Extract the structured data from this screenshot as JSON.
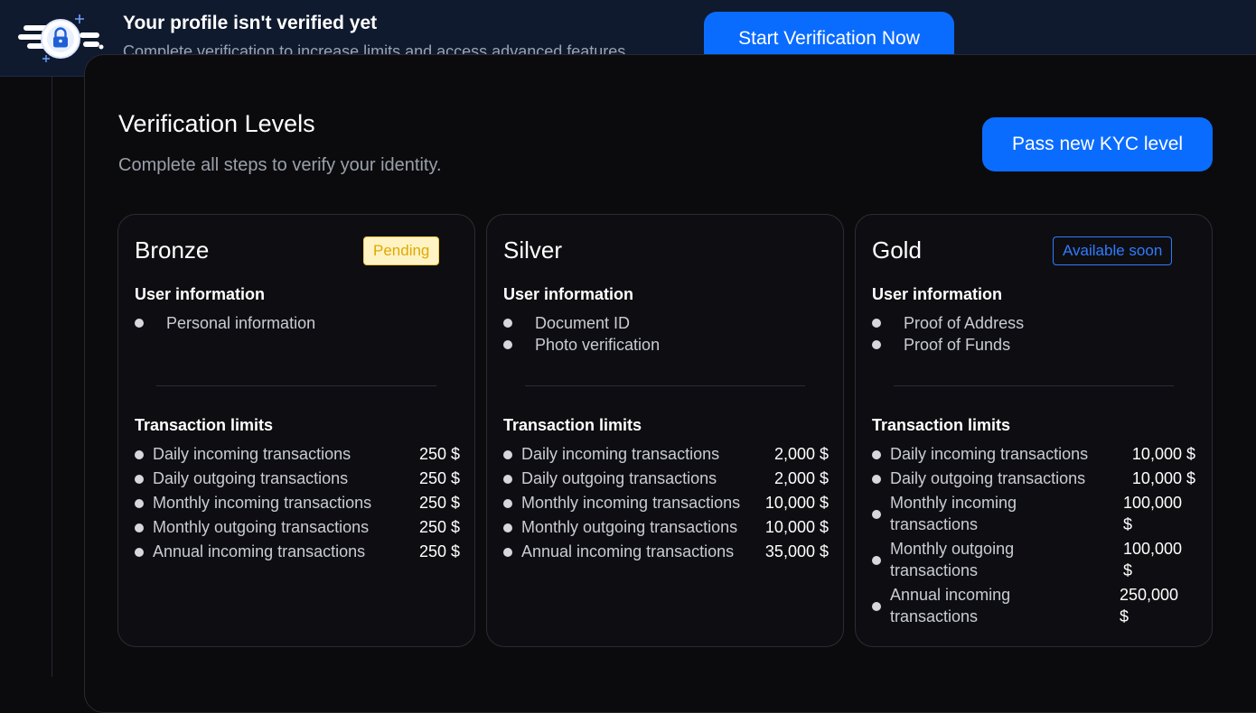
{
  "banner": {
    "title": "Your profile isn't verified yet",
    "subtitle": "Complete verification to increase limits and access advanced features",
    "button_label": "Start Verification Now",
    "icon": "lock-icon"
  },
  "levels": {
    "title": "Verification Levels",
    "subtitle": "Complete all steps to verify your identity.",
    "button_label": "Pass new KYC level"
  },
  "cards": [
    {
      "name": "Bronze",
      "badge": "Pending",
      "user_info_title": "User information",
      "user_info": [
        "Personal information"
      ],
      "limits_title": "Transaction limits",
      "limits": [
        {
          "label": "Daily incoming transactions",
          "value": "250 $"
        },
        {
          "label": "Daily outgoing transactions",
          "value": "250 $"
        },
        {
          "label": "Monthly incoming transactions",
          "value": "250 $"
        },
        {
          "label": "Monthly outgoing transactions",
          "value": "250 $"
        },
        {
          "label": "Annual incoming transactions",
          "value": "250 $"
        }
      ]
    },
    {
      "name": "Silver",
      "badge": "",
      "user_info_title": "User information",
      "user_info": [
        "Document ID",
        "Photo verification"
      ],
      "limits_title": "Transaction limits",
      "limits": [
        {
          "label": "Daily incoming transactions",
          "value": "2,000 $"
        },
        {
          "label": "Daily outgoing transactions",
          "value": "2,000 $"
        },
        {
          "label": "Monthly incoming transactions",
          "value": "10,000 $"
        },
        {
          "label": "Monthly outgoing transactions",
          "value": "10,000 $"
        },
        {
          "label": "Annual incoming transactions",
          "value": "35,000 $"
        }
      ]
    },
    {
      "name": "Gold",
      "badge": "Available soon",
      "user_info_title": "User information",
      "user_info": [
        "Proof of Address",
        "Proof of Funds"
      ],
      "limits_title": "Transaction limits",
      "limits": [
        {
          "label": "Daily incoming transactions",
          "value": "10,000 $"
        },
        {
          "label": "Daily outgoing transactions",
          "value": "10,000 $"
        },
        {
          "label": "Monthly incoming transactions",
          "value": "100,000 $"
        },
        {
          "label": "Monthly outgoing transactions",
          "value": "100,000 $"
        },
        {
          "label": "Annual incoming transactions",
          "value": "250,000 $"
        }
      ]
    }
  ],
  "colors": {
    "accent": "#0a6cff",
    "banner_bg": "#0f1a2e",
    "page_bg": "#0b0b0e",
    "pending_bg": "#fff3c4",
    "soon_border": "#2f7bff"
  }
}
